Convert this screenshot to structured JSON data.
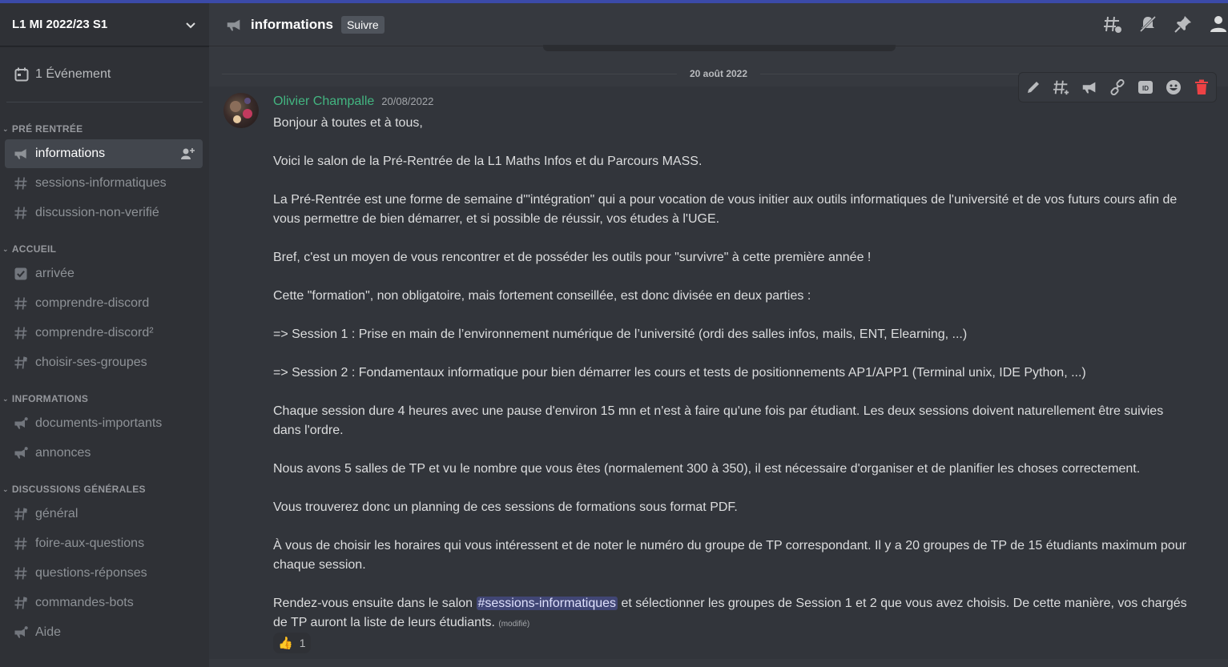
{
  "server": {
    "name": "L1 MI 2022/23 S1"
  },
  "events": {
    "label": "1 Événement"
  },
  "categories": [
    {
      "name": "PRÉ RENTRÉE",
      "channels": [
        {
          "name": "informations",
          "icon": "announcement-icon",
          "active": true
        },
        {
          "name": "sessions-informatiques",
          "icon": "hash-icon"
        },
        {
          "name": "discussion-non-verifié",
          "icon": "hash-icon"
        }
      ]
    },
    {
      "name": "ACCUEIL",
      "channels": [
        {
          "name": "arrivée",
          "icon": "rules-icon"
        },
        {
          "name": "comprendre-discord",
          "icon": "hash-icon"
        },
        {
          "name": "comprendre-discord²",
          "icon": "hash-icon"
        },
        {
          "name": "choisir-ses-groupes",
          "icon": "hash-thread-icon"
        }
      ]
    },
    {
      "name": "INFORMATIONS",
      "channels": [
        {
          "name": "documents-importants",
          "icon": "announcement-thread-icon"
        },
        {
          "name": "annonces",
          "icon": "announcement-thread-icon"
        }
      ]
    },
    {
      "name": "DISCUSSIONS GÉNÉRALES",
      "channels": [
        {
          "name": "général",
          "icon": "hash-thread-icon"
        },
        {
          "name": "foire-aux-questions",
          "icon": "hash-icon"
        },
        {
          "name": "questions-réponses",
          "icon": "hash-icon"
        },
        {
          "name": "commandes-bots",
          "icon": "hash-thread-icon"
        },
        {
          "name": "Aide",
          "icon": "announcement-thread-icon"
        }
      ]
    }
  ],
  "channel_header": {
    "title": "informations",
    "follow_label": "Suivre"
  },
  "date_divider": "20 août 2022",
  "message": {
    "author": "Olivier Champalle",
    "timestamp": "20/08/2022",
    "paragraphs": [
      "Bonjour à toutes et à tous,",
      "Voici le salon de la Pré-Rentrée de la L1 Maths Infos et du Parcours MASS.",
      "La Pré-Rentrée est une forme de semaine d'\"intégration\" qui a pour vocation de vous initier aux outils informatiques de l'université et de vos futurs cours afin de vous permettre de bien démarrer, et si possible de réussir, vos études à l'UGE.",
      "Bref, c'est un moyen de vous rencontrer et de posséder les outils pour \"survivre\" à cette première année !",
      "Cette \"formation\", non obligatoire, mais fortement conseillée, est donc divisée en deux parties :",
      "=> Session 1 : Prise en main de l’environnement numérique de l’université (ordi des salles infos, mails, ENT, Elearning, ...)",
      "=> Session 2 : Fondamentaux informatique pour bien démarrer les cours et tests de positionnements AP1/APP1 (Terminal unix, IDE Python, ...)",
      "Chaque session dure 4 heures avec une pause d'environ 15 mn et n'est à faire qu'une fois par étudiant. Les deux sessions doivent naturellement être suivies dans l'ordre.",
      "Nous avons 5 salles de TP et vu le nombre que vous êtes (normalement 300 à 350), il est nécessaire d'organiser et de planifier les choses correctement.",
      "Vous trouverez donc un planning de ces sessions de formations sous format PDF.",
      "À vous de choisir les horaires qui vous intéressent et de noter le numéro du groupe de TP correspondant. Il y a 20 groupes de TP de 15 étudiants maximum pour chaque session."
    ],
    "last_before": "Rendez-vous ensuite dans le salon ",
    "mention": "#sessions-informatiques",
    "last_after": " et sélectionner les groupes de Session 1 et 2 que vous avez choisis. De cette manière, vos chargés de TP auront la liste de leurs étudiants. ",
    "edited": "(modifié)",
    "reaction": {
      "emoji": "👍",
      "count": "1"
    }
  },
  "colors": {
    "author": "#43b581",
    "accent": "#5865f2",
    "delete": "#ed4245"
  }
}
